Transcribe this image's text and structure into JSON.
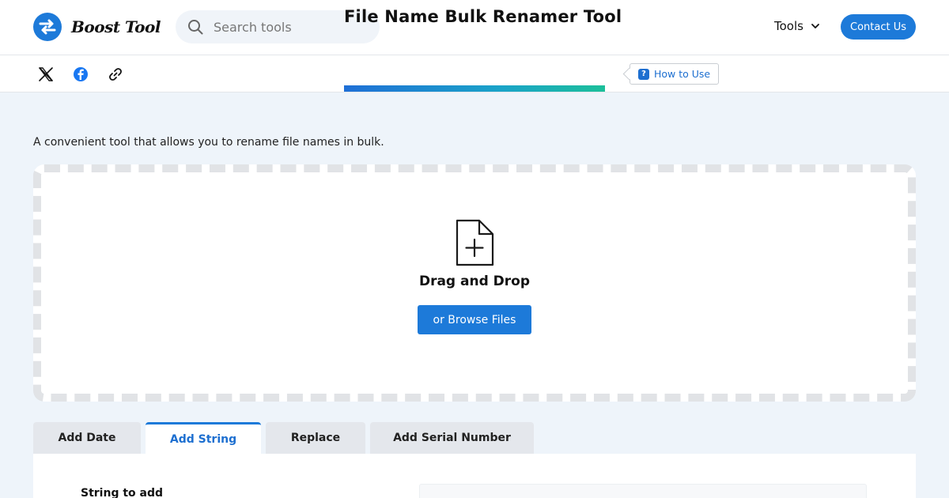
{
  "header": {
    "brand": "Boost Tool",
    "search": {
      "placeholder": "Search tools",
      "value": ""
    },
    "tools_label": "Tools",
    "contact_label": "Contact Us"
  },
  "subheader": {
    "share_icons": [
      "x-icon",
      "facebook-icon",
      "link-icon"
    ],
    "title": "File Name Bulk Renamer Tool",
    "how_to_use": "How to Use",
    "how_to_icon": "?"
  },
  "main": {
    "description": "A convenient tool that allows you to rename file names in bulk.",
    "dropzone": {
      "title": "Drag and Drop",
      "browse_label": "or Browse Files"
    },
    "tabs": [
      {
        "label": "Add Date",
        "active": false
      },
      {
        "label": "Add String",
        "active": true
      },
      {
        "label": "Replace",
        "active": false
      },
      {
        "label": "Add Serial Number",
        "active": false
      }
    ],
    "form": {
      "string_label": "String to add",
      "string_value": ""
    }
  },
  "colors": {
    "accent": "#1d7ad9",
    "page_bg": "#eef4fa",
    "tab_bg": "#e4e7ec",
    "dash": "#e1e3e6"
  }
}
